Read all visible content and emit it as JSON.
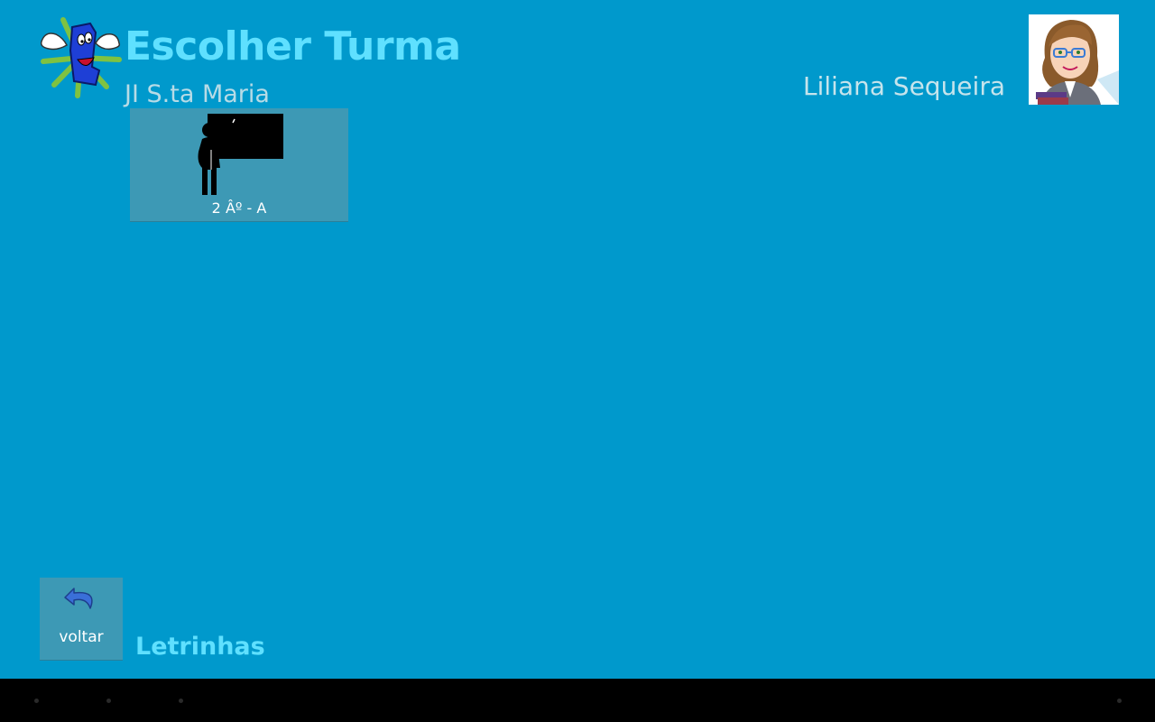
{
  "header": {
    "title": "Escolher Turma",
    "school": "JI S.ta Maria",
    "user_name": "Liliana Sequeira"
  },
  "classes": [
    {
      "label": "2 Âº - A",
      "icon": "teacher-blackboard-icon"
    }
  ],
  "footer": {
    "back_label": "voltar",
    "back_icon": "undo-arrow-icon",
    "app_name": "Letrinhas"
  },
  "icons": {
    "logo": "letrinhas-mascot-icon",
    "avatar": "teacher-avatar",
    "nav": [
      "back-nav-icon",
      "home-nav-icon",
      "recents-nav-icon",
      "menu-nav-icon"
    ]
  },
  "colors": {
    "background": "#0099cc",
    "title": "#5fe0ff",
    "tile": "#3d99b5",
    "subtitle": "#b7dbe6",
    "nav_bar": "#000000"
  }
}
